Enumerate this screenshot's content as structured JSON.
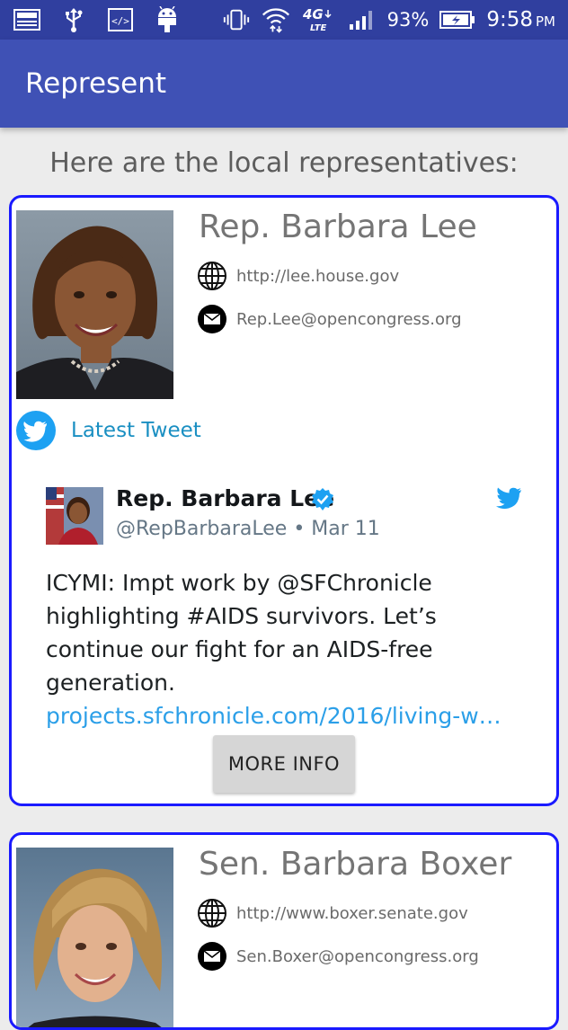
{
  "status_bar": {
    "battery": "93%",
    "time": "9:58",
    "ampm": "PM",
    "network": "4G LTE"
  },
  "app_bar": {
    "title": "Represent"
  },
  "heading": "Here are the local representatives:",
  "representatives": [
    {
      "name": "Rep. Barbara Lee",
      "website": "http://lee.house.gov",
      "email": "Rep.Lee@opencongress.org",
      "latest_tweet_label": "Latest Tweet",
      "tweet": {
        "author": "Rep. Barbara Lee",
        "handle_date": "@RepBarbaraLee • Mar 11",
        "text": "ICYMI: Impt work by @SFChronicle highlighting #AIDS survivors. Let’s continue our fight for an AIDS-free generation.",
        "link": "projects.sfchronicle.com/2016/living-wi…"
      },
      "more_info_label": "MORE INFO"
    },
    {
      "name": "Sen. Barbara Boxer",
      "website": "http://www.boxer.senate.gov",
      "email": "Sen.Boxer@opencongress.org"
    }
  ],
  "colors": {
    "status_bar": "#303f9f",
    "app_bar": "#3f51b5",
    "card_border": "#1a1aff",
    "twitter_blue": "#1da1f2",
    "link": "#2b9fe8"
  }
}
